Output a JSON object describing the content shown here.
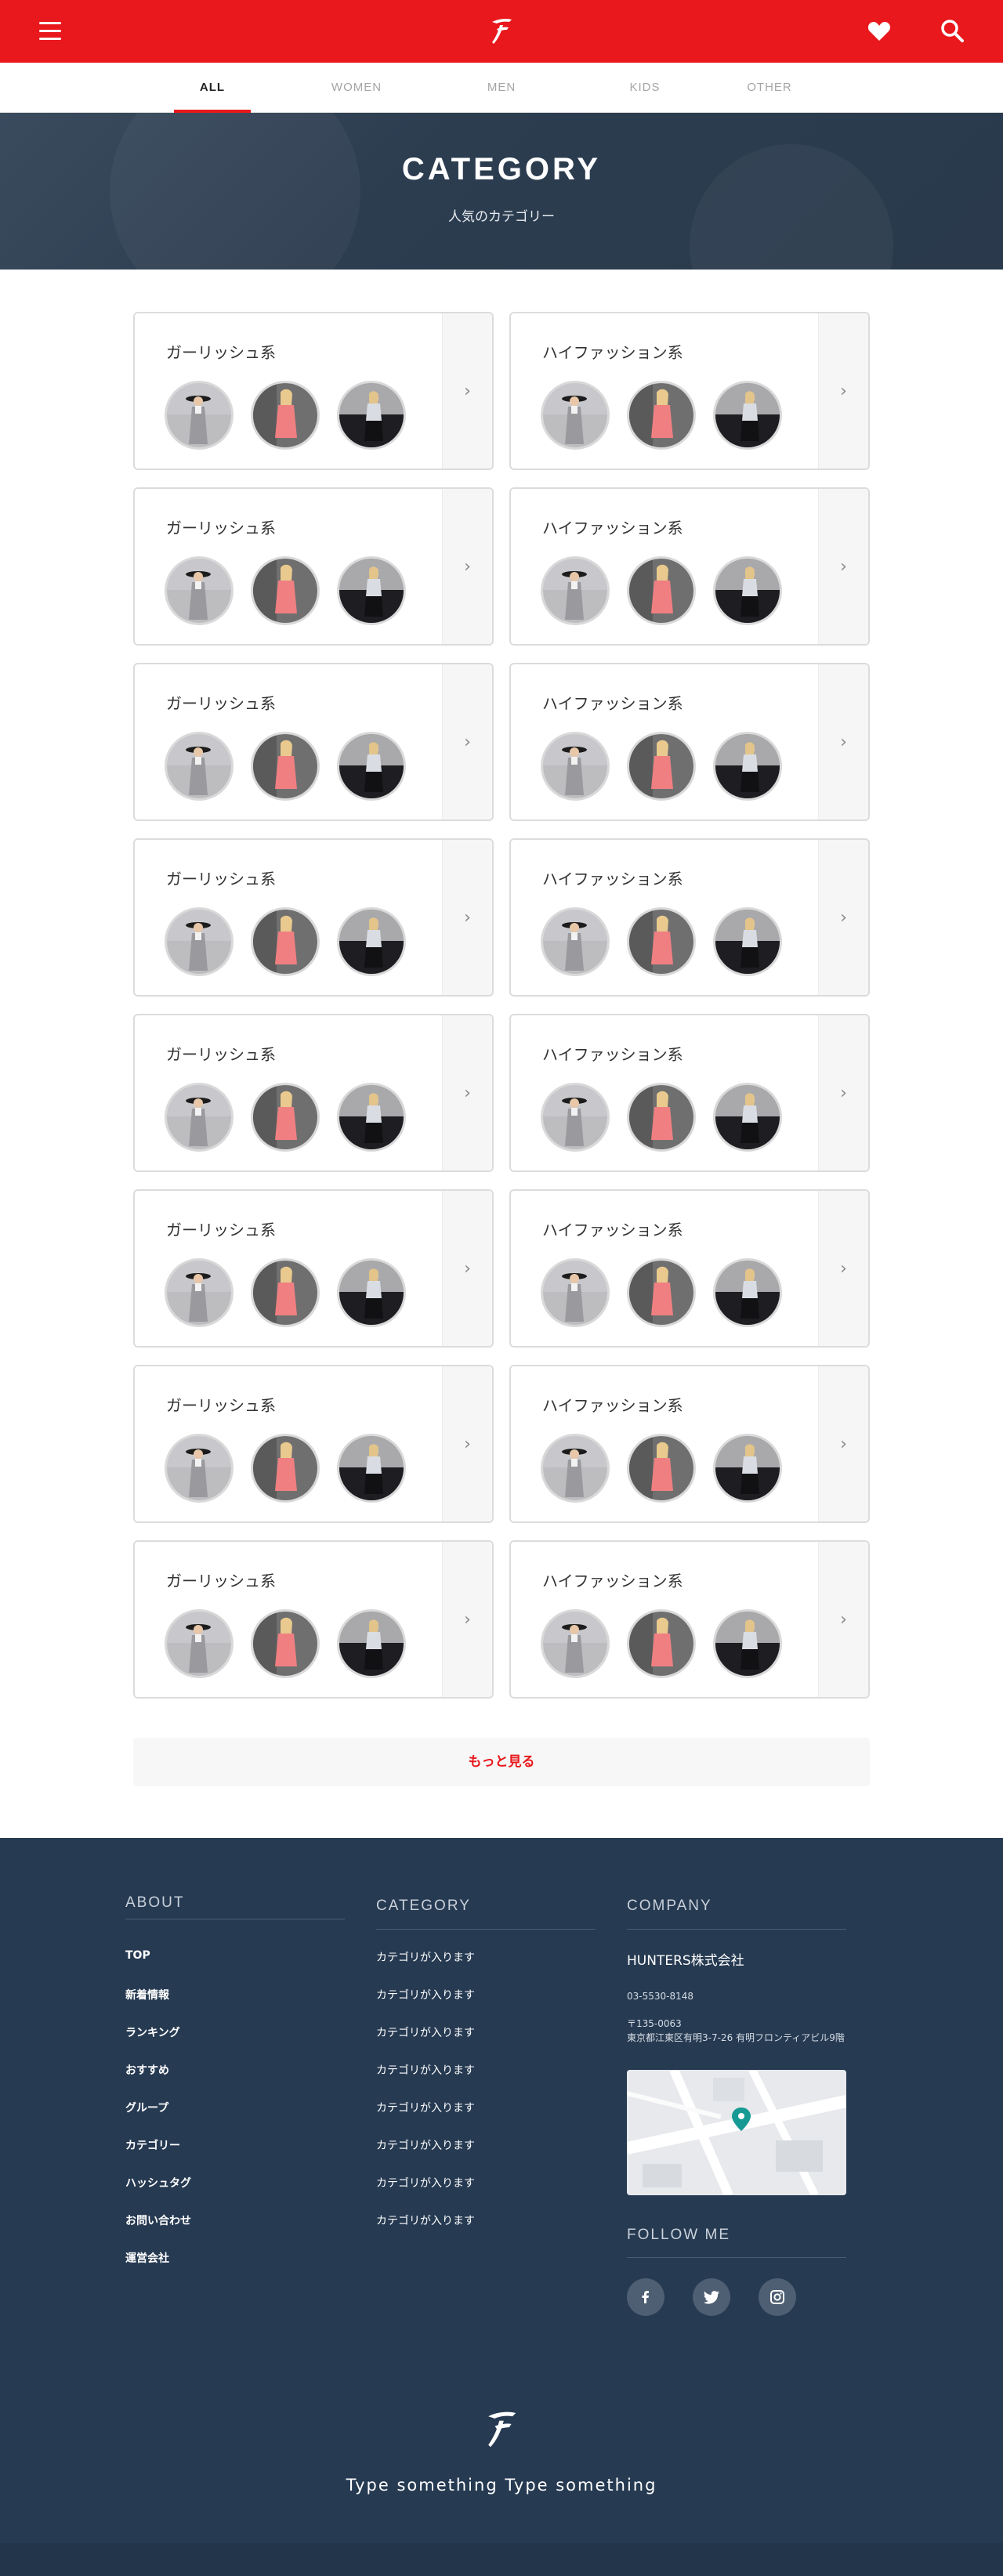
{
  "header": {
    "menu_icon": "hamburger-menu-icon",
    "logo_icon": "brand-logo-icon",
    "favorite_icon": "heart-icon",
    "search_icon": "search-icon",
    "bg_color": "#e8181c"
  },
  "tabs": [
    {
      "label": "ALL",
      "active": true
    },
    {
      "label": "WOMEN",
      "active": false
    },
    {
      "label": "MEN",
      "active": false
    },
    {
      "label": "KIDS",
      "active": false
    },
    {
      "label": "OTHER",
      "active": false
    }
  ],
  "hero": {
    "title": "CATEGORY",
    "subtitle": "人気のカテゴリー"
  },
  "categories": [
    {
      "left": "ガーリッシュ系",
      "right": "ハイファッション系"
    },
    {
      "left": "ガーリッシュ系",
      "right": "ハイファッション系"
    },
    {
      "left": "ガーリッシュ系",
      "right": "ハイファッション系"
    },
    {
      "left": "ガーリッシュ系",
      "right": "ハイファッション系"
    },
    {
      "left": "ガーリッシュ系",
      "right": "ハイファッション系"
    },
    {
      "left": "ガーリッシュ系",
      "right": "ハイファッション系"
    },
    {
      "left": "ガーリッシュ系",
      "right": "ハイファッション系"
    },
    {
      "left": "ガーリッシュ系",
      "right": "ハイファッション系"
    }
  ],
  "more_button": "もっと見る",
  "footer": {
    "about_title": "ABOUT",
    "about_links": [
      "TOP",
      "新着情報",
      "ランキング",
      "おすすめ",
      "グループ",
      "カテゴリー",
      "ハッシュタグ",
      "お問い合わせ",
      "運営会社"
    ],
    "category_title": "CATEGORY",
    "category_links": [
      "カテゴリが入ります",
      "カテゴリが入ります",
      "カテゴリが入ります",
      "カテゴリが入ります",
      "カテゴリが入ります",
      "カテゴリが入ります",
      "カテゴリが入ります",
      "カテゴリが入ります"
    ],
    "company_title": "COMPANY",
    "company_name": "HUNTERS株式会社",
    "company_tel": "03-5530-8148",
    "company_address": "〒135-0063\n東京都江東区有明3-7-26 有明フロンティアビル9階",
    "follow_title": "FOLLOW ME",
    "social_icons": [
      "facebook-icon",
      "twitter-icon",
      "instagram-icon"
    ],
    "tagline": "Type something Type something",
    "bg_color": "#263a52"
  }
}
